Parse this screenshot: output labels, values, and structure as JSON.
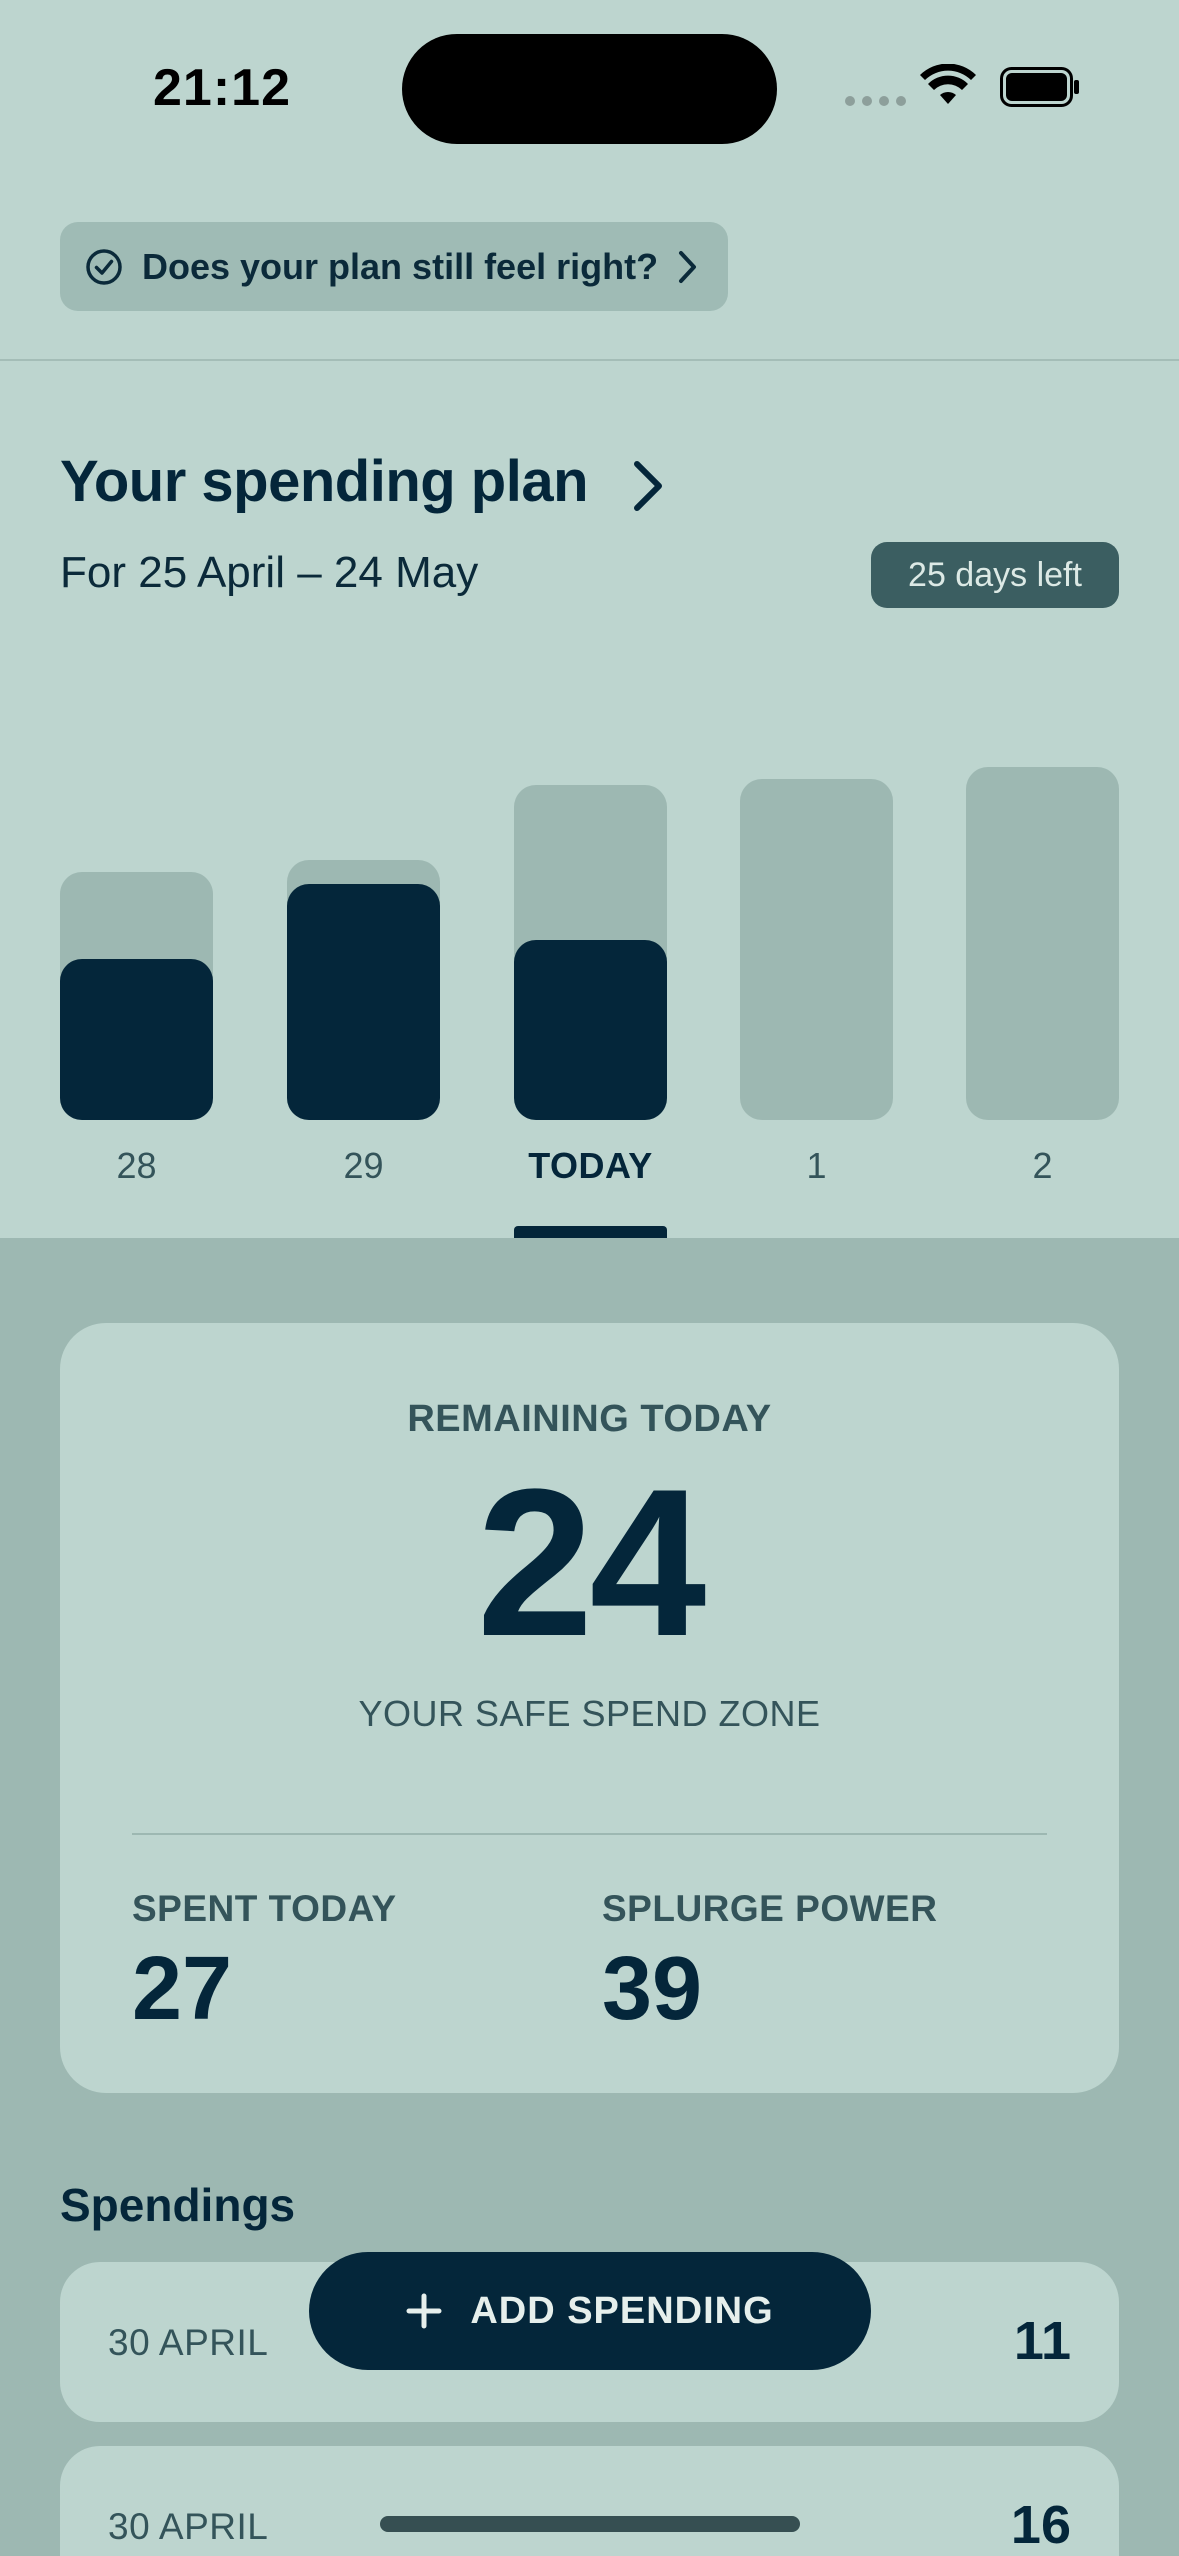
{
  "status_bar": {
    "time": "21:12"
  },
  "plan_check": {
    "label": "Does your plan still feel right?"
  },
  "plan": {
    "title": "Your spending plan",
    "range": "For 25 April – 24 May",
    "days_left": "25 days left"
  },
  "chart_data": {
    "type": "bar",
    "categories": [
      "28",
      "29",
      "TODAY",
      "1",
      "2"
    ],
    "series": [
      {
        "values": [
          40,
          42,
          54,
          55,
          57
        ]
      },
      {
        "values": [
          26,
          38,
          29,
          0,
          0
        ]
      }
    ],
    "selected": "TODAY"
  },
  "remaining": {
    "label": "REMAINING TODAY",
    "value": "24",
    "zone": "YOUR SAFE SPEND ZONE"
  },
  "stats": {
    "spent_label": "SPENT TODAY",
    "spent_value": "27",
    "splurge_label": "SPLURGE POWER",
    "splurge_value": "39"
  },
  "spendings": {
    "title": "Spendings",
    "items": [
      {
        "date": "30 APRIL",
        "amount": "11"
      },
      {
        "date": "30 APRIL",
        "amount": "16"
      }
    ]
  },
  "add_button": {
    "label": "ADD SPENDING"
  },
  "colors": {
    "background": "#bdd5cf",
    "panel": "#9db8b2",
    "ink": "#04263a",
    "badge": "#3b5e61"
  }
}
